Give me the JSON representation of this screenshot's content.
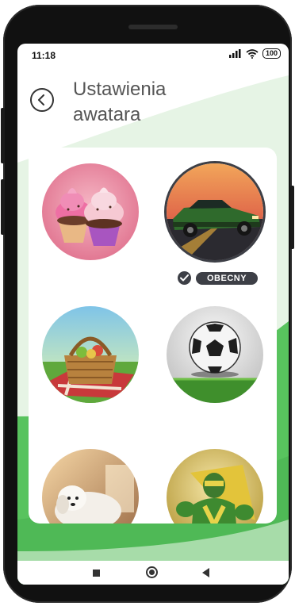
{
  "status_bar": {
    "time": "11:18",
    "signal_icon": "signal-icon",
    "wifi_icon": "wifi-icon",
    "battery": "100"
  },
  "header": {
    "back_icon": "chevron-left-icon",
    "title": "Ustawienia\nawatara"
  },
  "avatars": [
    {
      "subject": "cupcakes",
      "current": false
    },
    {
      "subject": "green-muscle-car",
      "current": true
    },
    {
      "subject": "picnic-basket",
      "current": false
    },
    {
      "subject": "soccer-ball",
      "current": false
    },
    {
      "subject": "white-dog",
      "current": false
    },
    {
      "subject": "green-superhero",
      "current": false
    }
  ],
  "current_badge": {
    "label": "OBECNY",
    "icon": "check-icon"
  },
  "nav_bar": {
    "recents_icon": "square-icon",
    "home_icon": "circle-icon",
    "back_icon": "triangle-back-icon"
  },
  "colors": {
    "accent_green": "#58c35e",
    "badge_dark": "#3d3f46",
    "title_gray": "#555555"
  }
}
